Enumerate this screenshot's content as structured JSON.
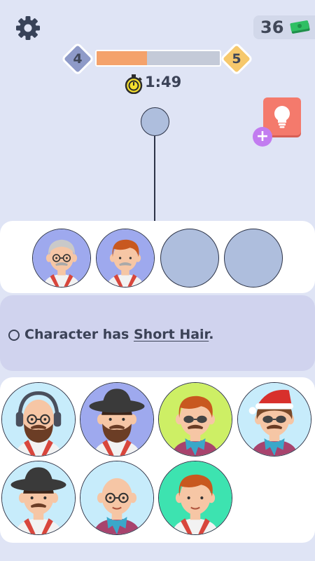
{
  "hud": {
    "money": "36",
    "level_current": "4",
    "level_next": "5",
    "progress": 0.41,
    "timer": "1:49"
  },
  "clue": {
    "prefix": "Character has ",
    "keyword": "Short Hair",
    "suffix": "."
  },
  "selected_slots": [
    {
      "filled": true,
      "bg": "#9ea9ee",
      "hair": "gray-curly",
      "glasses": true,
      "beard": false,
      "mustache": true,
      "shirt": "white-red"
    },
    {
      "filled": true,
      "bg": "#9ea9ee",
      "hair": "ginger",
      "glasses": false,
      "beard": false,
      "mustache": true,
      "shirt": "white-red"
    },
    {
      "filled": false
    },
    {
      "filled": false
    }
  ],
  "characters": [
    {
      "bg": "#c7ecfb",
      "hair": "bald-headphones",
      "glasses": true,
      "beard": true,
      "shirt": "white-red"
    },
    {
      "bg": "#9ea9ee",
      "hair": "hat",
      "glasses": false,
      "beard": true,
      "shirt": "white-red"
    },
    {
      "bg": "#cdef65",
      "hair": "ginger",
      "glasses": "sunglasses",
      "beard": false,
      "mustache": true,
      "shirt": "purple-scarf"
    },
    {
      "bg": "#c7ecfb",
      "hair": "santa-curly",
      "glasses": "sunglasses",
      "beard": false,
      "mustache": true,
      "shirt": "purple-scarf"
    },
    {
      "bg": "#c7ecfb",
      "hair": "hat",
      "glasses": false,
      "beard": false,
      "mustache": true,
      "shirt": "white-red"
    },
    {
      "bg": "#c7ecfb",
      "hair": "bald",
      "glasses": true,
      "beard": false,
      "mustache": false,
      "shirt": "purple-scarf"
    },
    {
      "bg": "#3de3b0",
      "hair": "ginger",
      "glasses": false,
      "beard": false,
      "mustache": false,
      "shirt": "white-red"
    }
  ],
  "colors": {
    "background": "#dfe4f5",
    "progress_fill": "#f4a26b",
    "hint_button": "#f47a6c",
    "hint_plus": "#c27cf0",
    "empty_slot": "#aebedd"
  },
  "icons": {
    "settings": "gear-icon",
    "money": "cash-icon",
    "timer": "stopwatch-icon",
    "hint": "lightbulb-icon",
    "add_hint": "plus-icon"
  }
}
